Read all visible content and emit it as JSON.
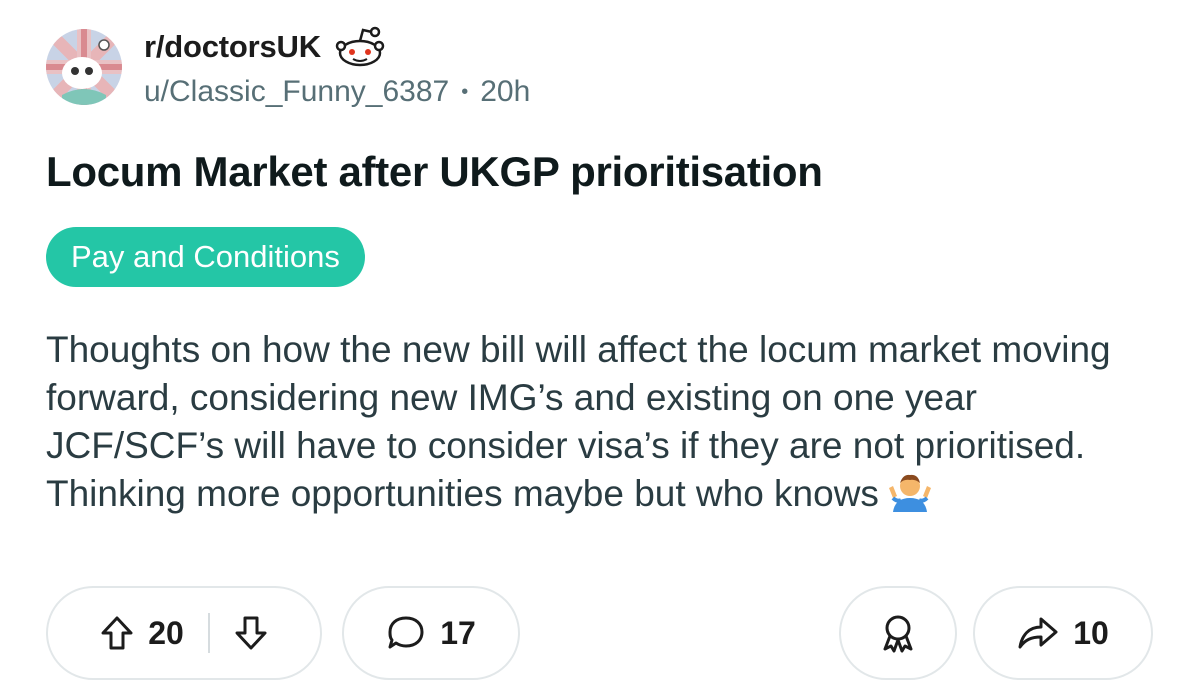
{
  "post": {
    "subreddit": "r/doctorsUK",
    "author": "u/Classic_Funny_6387",
    "separator": "•",
    "time_ago": "20h",
    "title": "Locum Market after UKGP prioritisation",
    "flair": "Pay and Conditions",
    "body": "Thoughts on how the new bill will affect the locum market moving forward, considering new IMG’s and existing on one year JCF/SCF’s will have to consider visa’s if they are not prioritised. Thinking more opportunities maybe but who knows",
    "body_emoji": "person-shrugging"
  },
  "actions": {
    "upvotes": "20",
    "comments": "17",
    "shares": "10"
  },
  "colors": {
    "flair_bg": "#24c6a6",
    "meta_text": "#576f76",
    "pill_border": "#e2e7e9"
  },
  "icons": [
    "subreddit-avatar",
    "snoo-icon",
    "upvote-icon",
    "downvote-icon",
    "comment-icon",
    "award-icon",
    "share-icon",
    "shrug-emoji"
  ]
}
